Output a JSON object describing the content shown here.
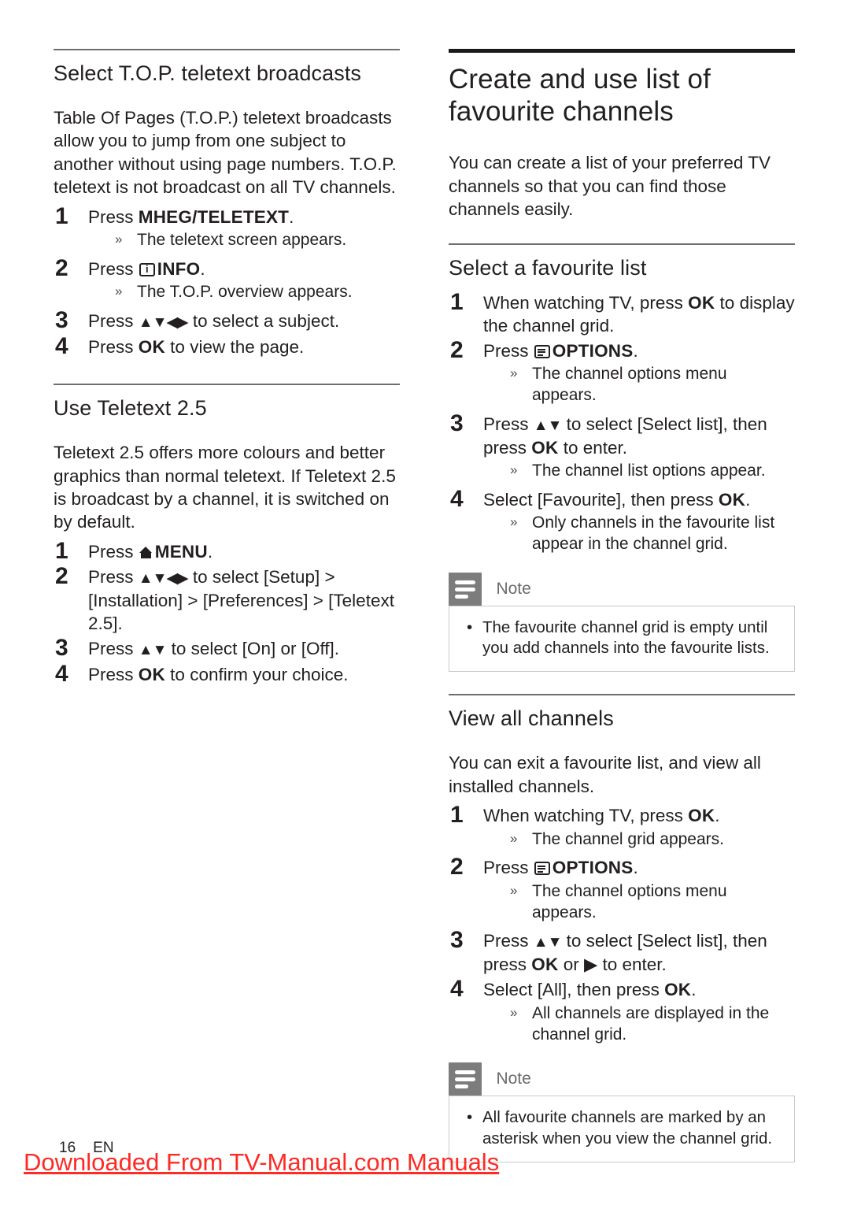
{
  "left_column": {
    "section1": {
      "heading": "Select T.O.P. teletext broadcasts",
      "intro": "Table Of Pages (T.O.P.) teletext broadcasts allow you to jump from one subject to another without using page numbers. T.O.P. teletext is not broadcast on all TV channels.",
      "steps": [
        {
          "num": "1",
          "pre": "Press ",
          "icon": "none",
          "bold": "MHEG/TELETEXT",
          "post": ".",
          "results": [
            "The teletext screen appears."
          ]
        },
        {
          "num": "2",
          "pre": "Press ",
          "icon": "info-icon",
          "bold": "INFO",
          "post": ".",
          "results": [
            "The T.O.P. overview appears."
          ]
        },
        {
          "num": "3",
          "pre": "Press ",
          "icon": "arrows-updownleftright",
          "bold": "",
          "post": " to select a subject.",
          "results": []
        },
        {
          "num": "4",
          "pre": "Press ",
          "icon": "none",
          "bold": "OK",
          "post": " to view the page.",
          "results": []
        }
      ]
    },
    "section2": {
      "heading": "Use Teletext 2.5",
      "intro": "Teletext 2.5 offers more colours and better graphics than normal teletext. If Teletext 2.5 is broadcast by a channel, it is switched on by default.",
      "steps": [
        {
          "num": "1",
          "pre": "Press ",
          "icon": "home-icon",
          "bold": "MENU",
          "post": ".",
          "results": []
        },
        {
          "num": "2",
          "pre": "Press ",
          "icon": "arrows-updownleftright",
          "bold": "",
          "post": " to select [Setup] > [Installation] > [Preferences] > [Teletext 2.5].",
          "results": []
        },
        {
          "num": "3",
          "pre": "Press ",
          "icon": "arrows-updown",
          "bold": "",
          "post": " to select [On] or [Off].",
          "results": []
        },
        {
          "num": "4",
          "pre": "Press ",
          "icon": "none",
          "bold": "OK",
          "post": " to confirm your choice.",
          "results": []
        }
      ]
    }
  },
  "right_column": {
    "main_heading": "Create and use list of favourite channels",
    "main_intro": "You can create a list of your preferred TV channels so that you can find those channels easily.",
    "section1": {
      "heading": "Select a favourite list",
      "steps": [
        {
          "num": "1",
          "pre": "When watching TV, press ",
          "icon": "none",
          "bold": "OK",
          "post": " to display the channel grid.",
          "results": []
        },
        {
          "num": "2",
          "pre": "Press ",
          "icon": "options-icon",
          "bold": "OPTIONS",
          "post": ".",
          "results": [
            "The channel options menu appears."
          ]
        },
        {
          "num": "3",
          "pre": "Press ",
          "icon": "arrows-updown",
          "bold": "",
          "post": " to select [Select list], then press ",
          "bold2": "OK",
          "post2": " to enter.",
          "results": [
            "The channel list options appear."
          ]
        },
        {
          "num": "4",
          "pre": "Select [Favourite], then press ",
          "icon": "none",
          "bold": "OK",
          "post": ".",
          "results": [
            "Only channels in the favourite list appear in the channel grid."
          ]
        }
      ],
      "note": {
        "label": "Note",
        "items": [
          "The favourite channel grid is empty until you add channels into the favourite lists."
        ]
      }
    },
    "section2": {
      "heading": "View all channels",
      "intro": "You can exit a favourite list, and view all installed channels.",
      "steps": [
        {
          "num": "1",
          "pre": "When watching TV, press ",
          "icon": "none",
          "bold": "OK",
          "post": ".",
          "results": [
            "The channel grid appears."
          ]
        },
        {
          "num": "2",
          "pre": "Press ",
          "icon": "options-icon",
          "bold": "OPTIONS",
          "post": ".",
          "results": [
            "The channel options menu appears."
          ]
        },
        {
          "num": "3",
          "pre": "Press ",
          "icon": "arrows-updown",
          "bold": "",
          "post": " to select [Select list], then press ",
          "bold2": "OK",
          "post2": " or ▶ to enter.",
          "results": []
        },
        {
          "num": "4",
          "pre": "Select [All], then press ",
          "icon": "none",
          "bold": "OK",
          "post": ".",
          "results": [
            "All channels are displayed in the channel grid."
          ]
        }
      ],
      "note": {
        "label": "Note",
        "items": [
          "All favourite channels are marked by an asterisk when you view the channel grid."
        ]
      }
    }
  },
  "footer": {
    "page_number": "16",
    "language": "EN",
    "watermark": "Downloaded From TV-Manual.com Manuals"
  },
  "colors": {
    "text": "#231f20",
    "rule_thin": "#6e6e6e",
    "rule_thick": "#1a1a1a",
    "note_tab": "#7c7c7c",
    "note_border": "#c9c9c9",
    "watermark": "#ff2a24"
  }
}
